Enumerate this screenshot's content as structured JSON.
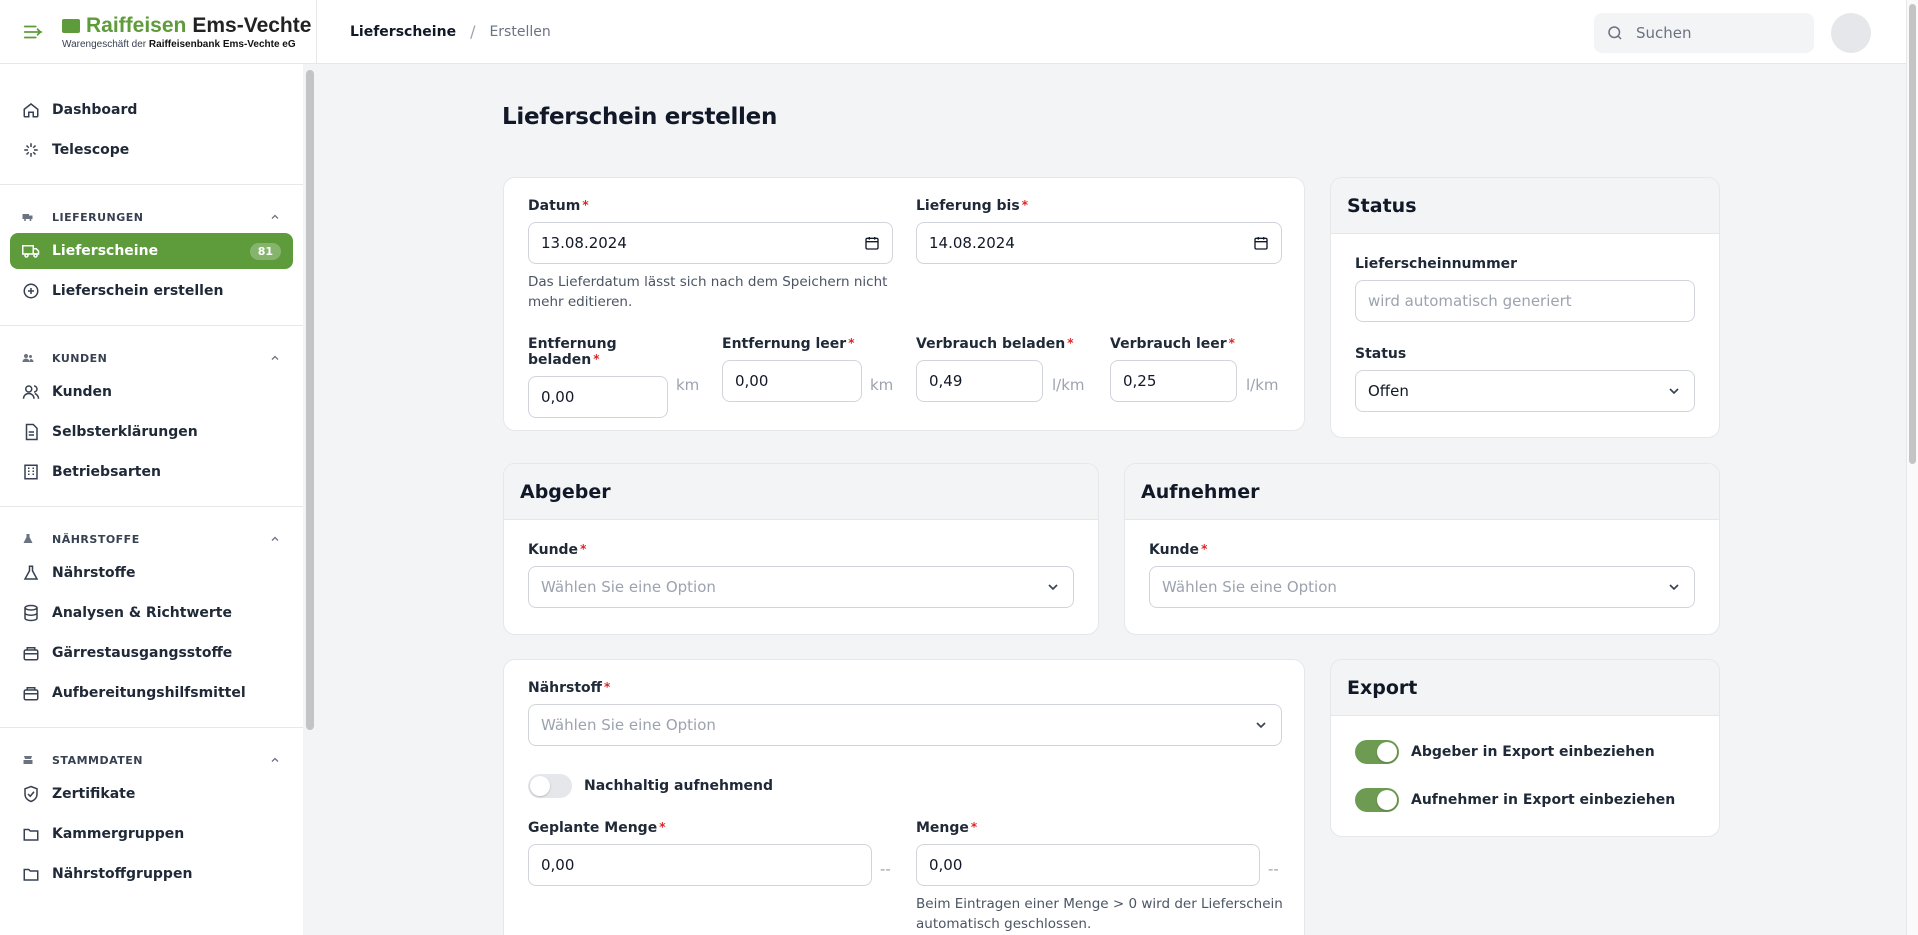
{
  "brand": {
    "name_green": "Raiffeisen",
    "name_dark": "Ems-Vechte",
    "sub_prefix": "Warengeschäft der",
    "sub_bank": "Raiffeisenbank Ems-Vechte eG",
    "accent": "#5e9b3b"
  },
  "sidebar": {
    "top_items": [
      {
        "label": "Dashboard",
        "icon": "home-icon"
      },
      {
        "label": "Telescope",
        "icon": "sparkle-icon"
      }
    ],
    "groups": [
      {
        "title": "LIEFERUNGEN",
        "items": [
          {
            "label": "Lieferscheine",
            "badge": "81",
            "active": true
          },
          {
            "label": "Lieferschein erstellen"
          }
        ]
      },
      {
        "title": "KUNDEN",
        "items": [
          {
            "label": "Kunden"
          },
          {
            "label": "Selbsterklärungen"
          },
          {
            "label": "Betriebsarten"
          }
        ]
      },
      {
        "title": "NÄHRSTOFFE",
        "items": [
          {
            "label": "Nährstoffe"
          },
          {
            "label": "Analysen & Richtwerte"
          },
          {
            "label": "Gärrestausgangsstoffe"
          },
          {
            "label": "Aufbereitungshilfsmittel"
          }
        ]
      },
      {
        "title": "STAMMDATEN",
        "items": [
          {
            "label": "Zertifikate"
          },
          {
            "label": "Kammergruppen"
          },
          {
            "label": "Nährstoffgruppen"
          }
        ]
      }
    ]
  },
  "topbar": {
    "breadcrumb": [
      "Lieferscheine",
      "Erstellen"
    ],
    "search_placeholder": "Suchen"
  },
  "page": {
    "title": "Lieferschein erstellen"
  },
  "form": {
    "datum": {
      "label": "Datum",
      "value": "13.08.2024",
      "hint": "Das Lieferdatum lässt sich nach dem Speichern nicht mehr editieren."
    },
    "lieferung_bis": {
      "label": "Lieferung bis",
      "value": "14.08.2024"
    },
    "entfernung_beladen": {
      "label": "Entfernung beladen",
      "value": "0,00",
      "unit": "km"
    },
    "entfernung_leer": {
      "label": "Entfernung leer",
      "value": "0,00",
      "unit": "km"
    },
    "verbrauch_beladen": {
      "label": "Verbrauch beladen",
      "value": "0,49",
      "unit": "l/km"
    },
    "verbrauch_leer": {
      "label": "Verbrauch leer",
      "value": "0,25",
      "unit": "l/km"
    }
  },
  "status_card": {
    "title": "Status",
    "nummer_label": "Lieferscheinnummer",
    "nummer_placeholder": "wird automatisch generiert",
    "status_label": "Status",
    "status_value": "Offen"
  },
  "abgeber": {
    "title": "Abgeber",
    "kunde_label": "Kunde",
    "kunde_placeholder": "Wählen Sie eine Option"
  },
  "aufnehmer": {
    "title": "Aufnehmer",
    "kunde_label": "Kunde",
    "kunde_placeholder": "Wählen Sie eine Option"
  },
  "naehrstoff_card": {
    "naehrstoff_label": "Nährstoff",
    "naehrstoff_placeholder": "Wählen Sie eine Option",
    "nachhaltig_label": "Nachhaltig aufnehmend",
    "nachhaltig_on": false,
    "geplante_menge_label": "Geplante Menge",
    "geplante_menge_value": "0,00",
    "geplante_unit": "--",
    "menge_label": "Menge",
    "menge_value": "0,00",
    "menge_unit": "--",
    "menge_hint": "Beim Eintragen einer Menge > 0 wird der Lieferschein automatisch geschlossen."
  },
  "export_card": {
    "title": "Export",
    "abgeber_label": "Abgeber in Export einbeziehen",
    "abgeber_on": true,
    "aufnehmer_label": "Aufnehmer in Export einbeziehen",
    "aufnehmer_on": true
  }
}
